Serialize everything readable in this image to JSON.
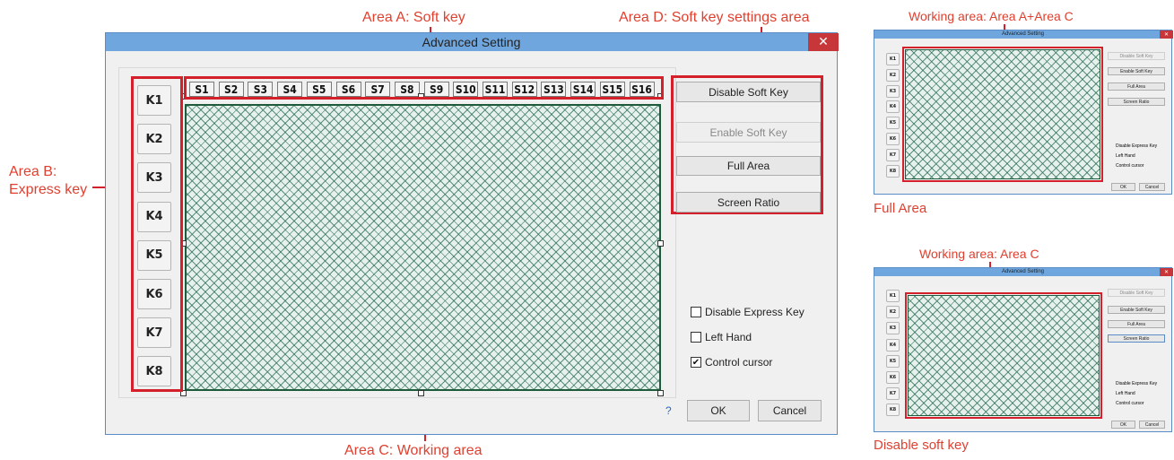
{
  "main": {
    "title": "Advanced Setting",
    "close_icon": "close-icon",
    "express_keys": [
      "K1",
      "K2",
      "K3",
      "K4",
      "K5",
      "K6",
      "K7",
      "K8"
    ],
    "soft_keys": [
      "S1",
      "S2",
      "S3",
      "S4",
      "S5",
      "S6",
      "S7",
      "S8",
      "S9",
      "S10",
      "S11",
      "S12",
      "S13",
      "S14",
      "S15",
      "S16"
    ],
    "buttons": {
      "disable_soft_key": "Disable Soft Key",
      "enable_soft_key": "Enable Soft Key",
      "full_area": "Full Area",
      "screen_ratio": "Screen Ratio"
    },
    "checkboxes": [
      {
        "label": "Disable Express Key",
        "checked": false
      },
      {
        "label": "Left Hand",
        "checked": false
      },
      {
        "label": "Control cursor",
        "checked": true
      }
    ],
    "help": "?",
    "ok": "OK",
    "cancel": "Cancel"
  },
  "annotations": {
    "area_a": "Area A: Soft key",
    "area_b_line1": "Area B:",
    "area_b_line2": "Express key",
    "area_c": "Area C: Working area",
    "area_d": "Area D: Soft key settings area",
    "full_caption": "Working area: Area A+Area C",
    "full_label": "Full Area",
    "disable_caption": "Working area: Area C",
    "disable_label": "Disable soft key"
  },
  "colors": {
    "annotation_red": "#d3202a",
    "annotation_text": "#e0402f",
    "title_bar": "#6fa6dd",
    "working_area_border": "#1e5a3c"
  }
}
